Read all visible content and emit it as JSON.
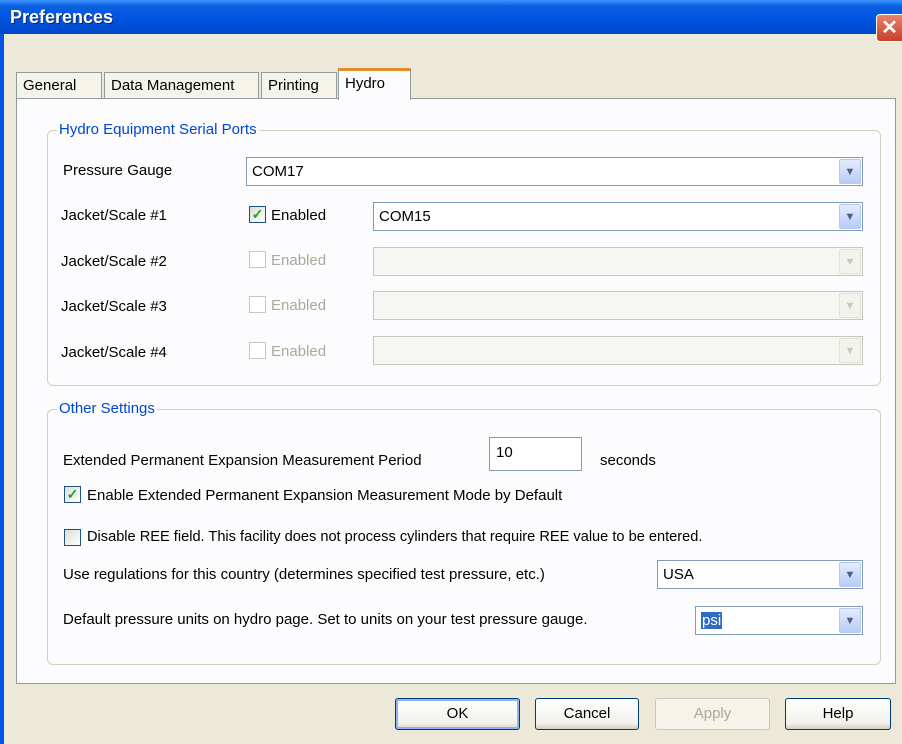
{
  "window": {
    "title": "Preferences",
    "close_glyph": "✕"
  },
  "tabs": [
    {
      "label": "General",
      "active": false
    },
    {
      "label": "Data Management",
      "active": false
    },
    {
      "label": "Printing",
      "active": false
    },
    {
      "label": "Hydro",
      "active": true
    }
  ],
  "serial_ports": {
    "legend": "Hydro Equipment Serial Ports",
    "pressure_gauge": {
      "label": "Pressure Gauge",
      "value": "COM17"
    },
    "jackets": [
      {
        "label": "Jacket/Scale #1",
        "enabled_label": "Enabled",
        "checked": true,
        "enabled": true,
        "value": "COM15"
      },
      {
        "label": "Jacket/Scale #2",
        "enabled_label": "Enabled",
        "checked": false,
        "enabled": false,
        "value": ""
      },
      {
        "label": "Jacket/Scale #3",
        "enabled_label": "Enabled",
        "checked": false,
        "enabled": false,
        "value": ""
      },
      {
        "label": "Jacket/Scale #4",
        "enabled_label": "Enabled",
        "checked": false,
        "enabled": false,
        "value": ""
      }
    ]
  },
  "other_settings": {
    "legend": "Other Settings",
    "measurement_period": {
      "label": "Extended Permanent Expansion Measurement Period",
      "value": "10",
      "unit": "seconds"
    },
    "enable_extended_mode": {
      "label": "Enable Extended Permanent Expansion Measurement Mode by Default",
      "checked": true
    },
    "disable_ree": {
      "label": "Disable REE field. This facility does not process cylinders that require REE value to be entered.",
      "checked": false
    },
    "country": {
      "label": "Use regulations for this country (determines specified test pressure, etc.)",
      "value": "USA"
    },
    "pressure_units": {
      "label": "Default pressure units on hydro page. Set to units on your test pressure gauge.",
      "value": "psi"
    }
  },
  "buttons": {
    "ok": "OK",
    "cancel": "Cancel",
    "apply": "Apply",
    "help": "Help"
  },
  "glyphs": {
    "check": "✓",
    "dropdown": "▼"
  }
}
